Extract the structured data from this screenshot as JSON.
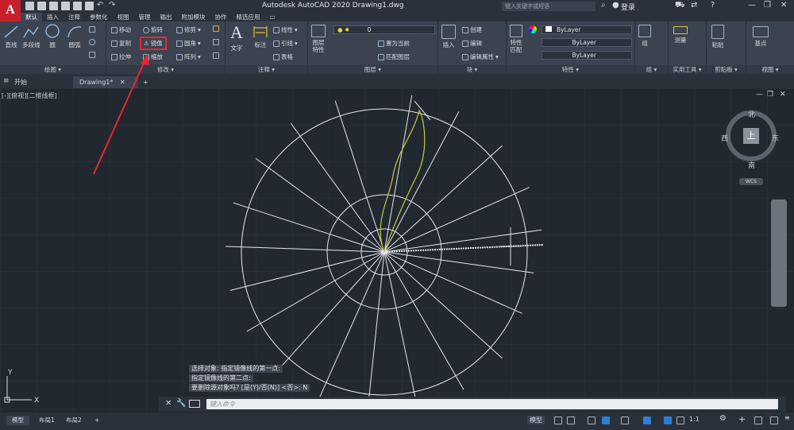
{
  "app": {
    "title": "Autodesk AutoCAD 2020    Drawing1.dwg",
    "search_placeholder": "键入关键字或短语",
    "login": "登录",
    "logo": "A"
  },
  "menu": [
    "默认",
    "插入",
    "注释",
    "参数化",
    "视图",
    "管理",
    "输出",
    "附加模块",
    "协作",
    "精选应用"
  ],
  "ribbon": {
    "draw": {
      "label": "绘图",
      "line": "直线",
      "polyline": "多段线",
      "circle": "圆",
      "arc": "圆弧"
    },
    "modify": {
      "label": "修改",
      "move": "移动",
      "rotate": "旋转",
      "trim": "修剪",
      "copy": "复制",
      "mirror": "镜像",
      "fillet": "圆角",
      "stretch": "拉伸",
      "scale": "缩放",
      "array": "阵列"
    },
    "annotation": {
      "label": "注释",
      "text": "文字",
      "dimension": "标注",
      "linear": "线性",
      "leader": "引线",
      "table": "表格"
    },
    "layers": {
      "label": "图层",
      "layer_props": "图层\n特性",
      "layer_value": "0",
      "set_current": "置为当前",
      "match_layer": "匹配图层"
    },
    "block": {
      "label": "块",
      "insert": "插入",
      "create": "创建",
      "edit": "编辑",
      "edit_attr": "编辑属性"
    },
    "properties": {
      "label": "特性",
      "match": "特性\n匹配",
      "color": "ByLayer",
      "linetype": "ByLayer",
      "lineweight": "ByLayer"
    },
    "groups": {
      "label": "组",
      "group": "组"
    },
    "utilities": {
      "label": "实用工具",
      "measure": "测量"
    },
    "clipboard": {
      "label": "剪贴板",
      "paste": "粘贴"
    },
    "view": {
      "label": "视图",
      "base": "基点"
    }
  },
  "tabs": {
    "start": "开始",
    "drawing": "Drawing1*",
    "add": "+"
  },
  "viewport": {
    "label": "[-][俯视][二维线框]",
    "compass": {
      "north": "北",
      "south": "南",
      "east": "东",
      "west": "西",
      "face": "上"
    },
    "wcs": "WCS"
  },
  "command": {
    "history": [
      "选择对象:  指定镜像线的第一点:",
      "指定镜像线的第二点:",
      "要删除源对象吗? [是(Y)/否(N)] <否>: N"
    ],
    "placeholder": "键入命令"
  },
  "status": {
    "tabs": [
      "模型",
      "布局1",
      "布局2",
      "+"
    ],
    "model": "模型",
    "scale": "1:1"
  },
  "colors": {
    "accent": "#2b7fd6",
    "highlight": "#e8282e",
    "curve": "#c8cc3a",
    "lines": "#e6e8ea"
  }
}
